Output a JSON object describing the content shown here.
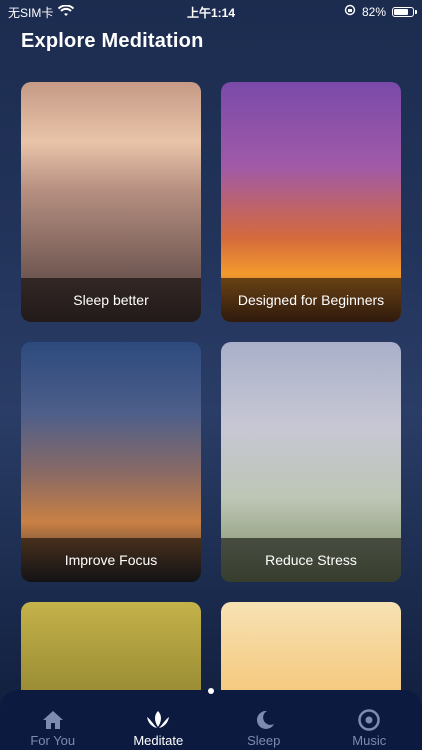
{
  "status_bar": {
    "carrier": "无SIM卡",
    "time": "上午1:14",
    "battery": "82%",
    "battery_level": 0.82
  },
  "page_title": "Explore Meditation",
  "cards": [
    {
      "label": "Sleep better"
    },
    {
      "label": "Designed for Beginners"
    },
    {
      "label": "Improve Focus"
    },
    {
      "label": "Reduce Stress"
    },
    {
      "label": ""
    },
    {
      "label": ""
    }
  ],
  "tabs": [
    {
      "label": "For You",
      "icon": "home-icon"
    },
    {
      "label": "Meditate",
      "icon": "lotus-icon",
      "active": true
    },
    {
      "label": "Sleep",
      "icon": "moon-icon"
    },
    {
      "label": "Music",
      "icon": "music-disc-icon"
    }
  ]
}
